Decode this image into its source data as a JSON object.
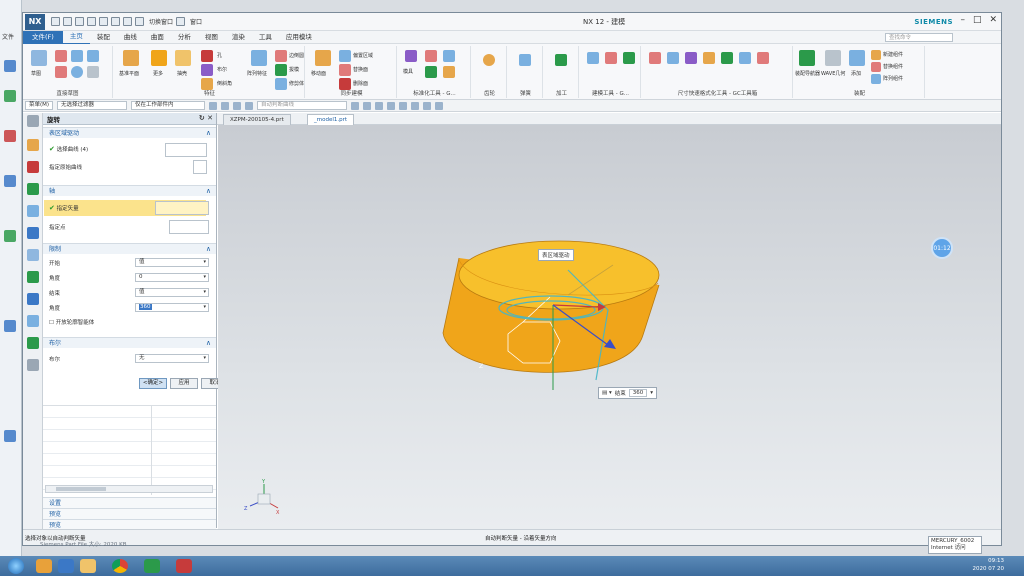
{
  "app": {
    "logo": "NX",
    "title": "NX 12 - 建模",
    "brand": "SIEMENS",
    "qat_text": [
      "切换窗口",
      "窗口"
    ],
    "window_controls": [
      "–",
      "□",
      "✕"
    ]
  },
  "menu": {
    "file": "文件(F)",
    "tabs": [
      "主页",
      "装配",
      "曲线",
      "曲面",
      "分析",
      "视图",
      "渲染",
      "工具",
      "应用模块"
    ],
    "active_tab": "主页",
    "search_placeholder": "查找命令"
  },
  "ribbon": {
    "groups": [
      "直接草图",
      "特征",
      "同步建模",
      "标准化工具 - G...",
      "齿轮",
      "弹簧",
      "加工",
      "建模工具 - G...",
      "尺寸快速格式化工具 - GC工具箱",
      "装配"
    ],
    "labels": {
      "sketch": "草图",
      "datum": "基准平面",
      "extrude_more": "更多",
      "shell": "抽壳",
      "merge": "合并",
      "edge_blend": "边倒圆",
      "more": "更多",
      "move_face": "移动面",
      "delete_face": "删除面",
      "replace_face": "替换面",
      "offset_region": "偏置区域",
      "mold": "模具",
      "assembly_nav": "装配导航器",
      "add": "添加",
      "wave": "WAVE几何",
      "new_comp": "新建组件",
      "replace_comp": "替换组件",
      "array_comp": "阵列组件",
      "move_comp": "移动组件",
      "assembly_constraint": "装配约束",
      "hole": "孔",
      "boolean": "布尔",
      "chamfer": "倒斜角",
      "emboss": "拔模",
      "trim_body": "修剪体",
      "pattern": "阵列特征",
      "unite": "合并"
    }
  },
  "selbar": {
    "menu": "菜单(M)",
    "filter": "无选择过滤器",
    "scope": "仅在工作部件内",
    "snap": "自动判断曲线"
  },
  "doc_tabs": [
    {
      "label": "XZPM-200105-4.prt",
      "active": false
    },
    {
      "label": "_model1.prt",
      "active": true
    }
  ],
  "dialog": {
    "title": "旋转",
    "sections": {
      "section_curve": {
        "header": "表区域驱动",
        "select_curve": "选择曲线 (4)",
        "sketch_section": "指定原始曲线"
      },
      "axis": {
        "header": "轴",
        "specify_vector": "指定矢量",
        "specify_point": "指定点"
      },
      "limits": {
        "header": "限制",
        "start": "开始",
        "start_value": "值",
        "angle": "角度",
        "angle_value": "0",
        "end": "结束",
        "end_value": "值",
        "end_angle_label": "角度",
        "end_angle_value": "360",
        "open_profile": "开放轮廓智能体"
      },
      "boolean": {
        "header": "布尔",
        "label": "布尔",
        "value": "无"
      }
    },
    "buttons": {
      "ok": "<确定>",
      "apply": "应用",
      "cancel": "取消"
    },
    "collapsed": [
      "设置",
      "预览",
      "预览"
    ]
  },
  "viewport": {
    "tip_surface": "表区域驱动",
    "angle_label": "结束",
    "angle_value": "360",
    "timer": "01:12",
    "axis_z": "Z",
    "axis_y": "Y",
    "axis_x": "X"
  },
  "status": {
    "left": "选择对象以自动判断矢量",
    "middle": "自动判断矢量 - 沿着矢量方向"
  },
  "taskbar": {
    "time": "09:13",
    "date": "2020 07 20"
  },
  "notification": [
    "MERCURY_6002",
    "Internet 访问"
  ],
  "ghost": "Siemens Part File    大小: 2020 KB",
  "background": {
    "edge_text": "文件"
  },
  "colors": {
    "accent": "#2f72b7",
    "solid": "#f0a51a",
    "solid_top": "#f7c02c",
    "highlight": "#fbe38c"
  }
}
